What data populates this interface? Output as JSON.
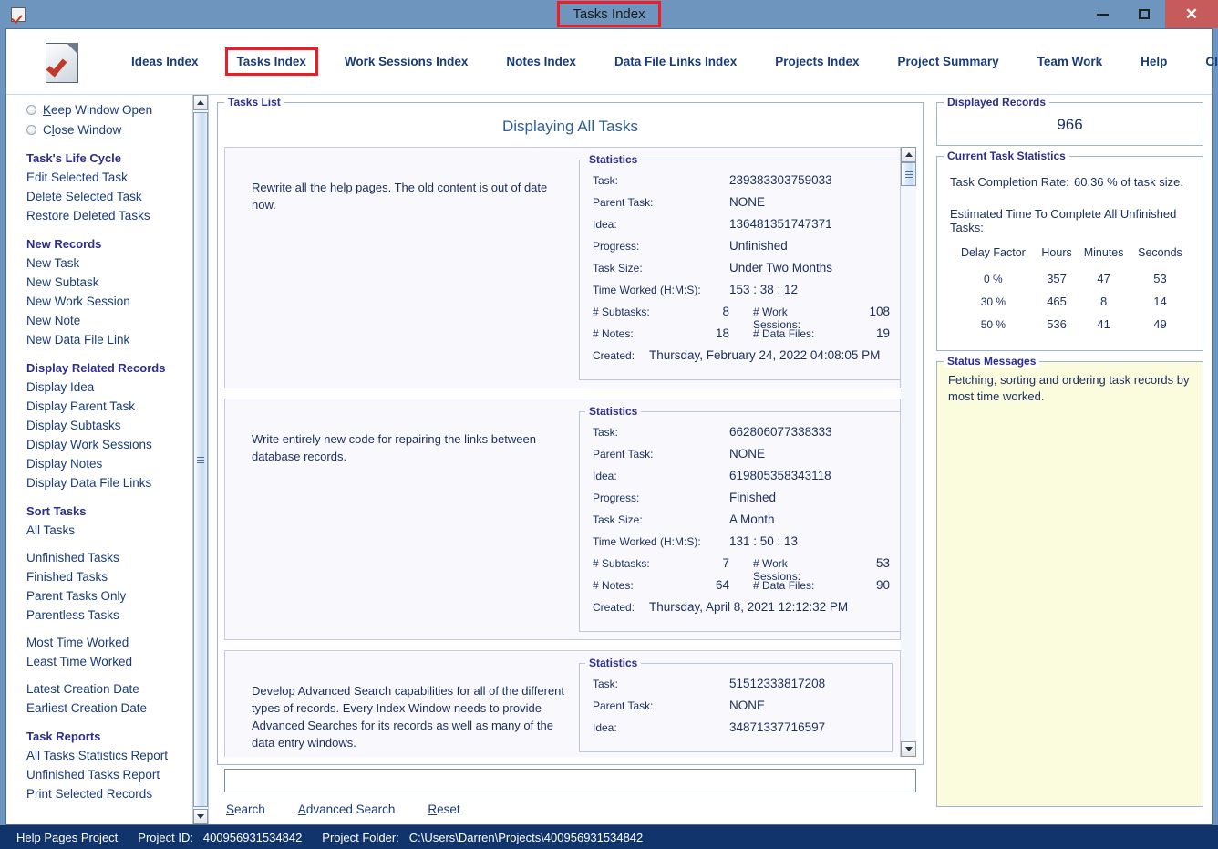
{
  "window": {
    "title": "Tasks Index",
    "app_icon": "checked-document-icon",
    "minimize_label": "",
    "maximize_label": "",
    "close_label": "✕"
  },
  "nav": {
    "items": [
      {
        "label": "Ideas Index",
        "accel": "I",
        "active": false
      },
      {
        "label": "Tasks Index",
        "accel": "T",
        "active": true
      },
      {
        "label": "Work Sessions Index",
        "accel": "W",
        "active": false
      },
      {
        "label": "Notes Index",
        "accel": "N",
        "active": false
      },
      {
        "label": "Data File Links Index",
        "accel": "D",
        "active": false
      },
      {
        "label": "Projects Index",
        "accel": "",
        "active": false
      },
      {
        "label": "Project Summary",
        "accel": "P",
        "active": false
      },
      {
        "label": "Team Work",
        "accel": "e",
        "active": false
      },
      {
        "label": "Help",
        "accel": "H",
        "active": false
      },
      {
        "label": "Close Program",
        "accel": "C",
        "active": false
      }
    ]
  },
  "sidebar": {
    "radios": [
      {
        "label": "Keep Window Open",
        "accel": "K",
        "selected": false
      },
      {
        "label": "Close Window",
        "accel": "l",
        "selected": false
      }
    ],
    "groups": [
      {
        "heading": "Task's Life Cycle",
        "items": [
          "Edit Selected Task",
          "Delete Selected Task",
          "Restore Deleted Tasks"
        ]
      },
      {
        "heading": "New Records",
        "items": [
          "New Task",
          "New Subtask",
          "New Work Session",
          "New Note",
          "New Data File Link"
        ]
      },
      {
        "heading": "Display Related Records",
        "items": [
          "Display Idea",
          "Display Parent Task",
          "Display Subtasks",
          "Display Work Sessions",
          "Display Notes",
          "Display Data File Links"
        ]
      },
      {
        "heading": "Sort Tasks",
        "items": [
          "All Tasks",
          "",
          "Unfinished Tasks",
          "Finished Tasks",
          "Parent Tasks Only",
          "Parentless Tasks",
          "",
          "Most Time Worked",
          "Least Time Worked",
          "",
          "Latest Creation Date",
          "Earliest Creation Date"
        ]
      },
      {
        "heading": "Task Reports",
        "items": [
          "All Tasks Statistics Report",
          "Unfinished Tasks Report",
          "Print Selected Records"
        ]
      }
    ]
  },
  "tasks_list": {
    "legend": "Tasks List",
    "title": "Displaying All Tasks",
    "stats_legend": "Statistics",
    "labels": {
      "task": "Task:",
      "parent_task": "Parent Task:",
      "idea": "Idea:",
      "progress": "Progress:",
      "task_size": "Task Size:",
      "time_worked": "Time Worked (H:M:S):",
      "subtasks": "# Subtasks:",
      "work_sessions": "# Work Sessions:",
      "notes": "# Notes:",
      "data_files": "# Data Files:",
      "created": "Created:"
    },
    "records": [
      {
        "description": "Rewrite all the help pages. The old content is out of date now.",
        "task": "239383303759033",
        "parent_task": "NONE",
        "idea": "136481351747371",
        "progress": "Unfinished",
        "task_size": "Under Two Months",
        "time_worked": "153  : 38 : 12",
        "subtasks": "8",
        "work_sessions": "108",
        "notes": "18",
        "data_files": "19",
        "created": "Thursday, February 24, 2022   04:08:05 PM"
      },
      {
        "description": "Write entirely new code for repairing the links between database records.",
        "task": "662806077338333",
        "parent_task": "NONE",
        "idea": "619805358343118",
        "progress": "Finished",
        "task_size": "A Month",
        "time_worked": "131  : 50 : 13",
        "subtasks": "7",
        "work_sessions": "53",
        "notes": "64",
        "data_files": "90",
        "created": "Thursday, April 8, 2021   12:12:32 PM"
      },
      {
        "description": "Develop Advanced Search capabilities for all of the different types of records. Every Index Window needs to provide Advanced Searches for its records as well as many of the data entry windows.",
        "task": "51512333817208",
        "parent_task": "NONE",
        "idea": "34871337716597",
        "progress": "",
        "task_size": "",
        "time_worked": "",
        "subtasks": "",
        "work_sessions": "",
        "notes": "",
        "data_files": "",
        "created": ""
      }
    ]
  },
  "search": {
    "value": "",
    "placeholder": "",
    "buttons": [
      {
        "label": "Search",
        "accel": "S"
      },
      {
        "label": "Advanced Search",
        "accel": "A"
      },
      {
        "label": "Reset",
        "accel": "R"
      }
    ]
  },
  "displayed_records": {
    "legend": "Displayed Records",
    "value": "966"
  },
  "current_task_statistics": {
    "legend": "Current Task Statistics",
    "completion_rate_label": "Task Completion Rate:",
    "completion_rate_value": "60.36 % of task size.",
    "estimate_heading": "Estimated Time To Complete All Unfinished Tasks:",
    "table": {
      "headers": [
        "Delay Factor",
        "Hours",
        "Minutes",
        "Seconds"
      ],
      "rows": [
        [
          "0 %",
          "357",
          "47",
          "53"
        ],
        [
          "30 %",
          "465",
          "8",
          "14"
        ],
        [
          "50 %",
          "536",
          "41",
          "49"
        ]
      ]
    }
  },
  "status_messages": {
    "legend": "Status Messages",
    "text": "Fetching, sorting and ordering task records by most time worked."
  },
  "statusbar": {
    "project_name": "Help Pages Project",
    "project_id_label": "Project ID:",
    "project_id": "400956931534842",
    "project_folder_label": "Project Folder:",
    "project_folder": "C:\\Users\\Darren\\Projects\\400956931534842"
  },
  "colors": {
    "titlebar": "#6e95bd",
    "accent_red": "#ee1c25",
    "link_blue": "#1a3c7a",
    "heading_blue": "#2b2d8f",
    "status_bar": "#10346b",
    "status_message_bg": "#fbfbdd",
    "close_button": "#c75b5b"
  }
}
